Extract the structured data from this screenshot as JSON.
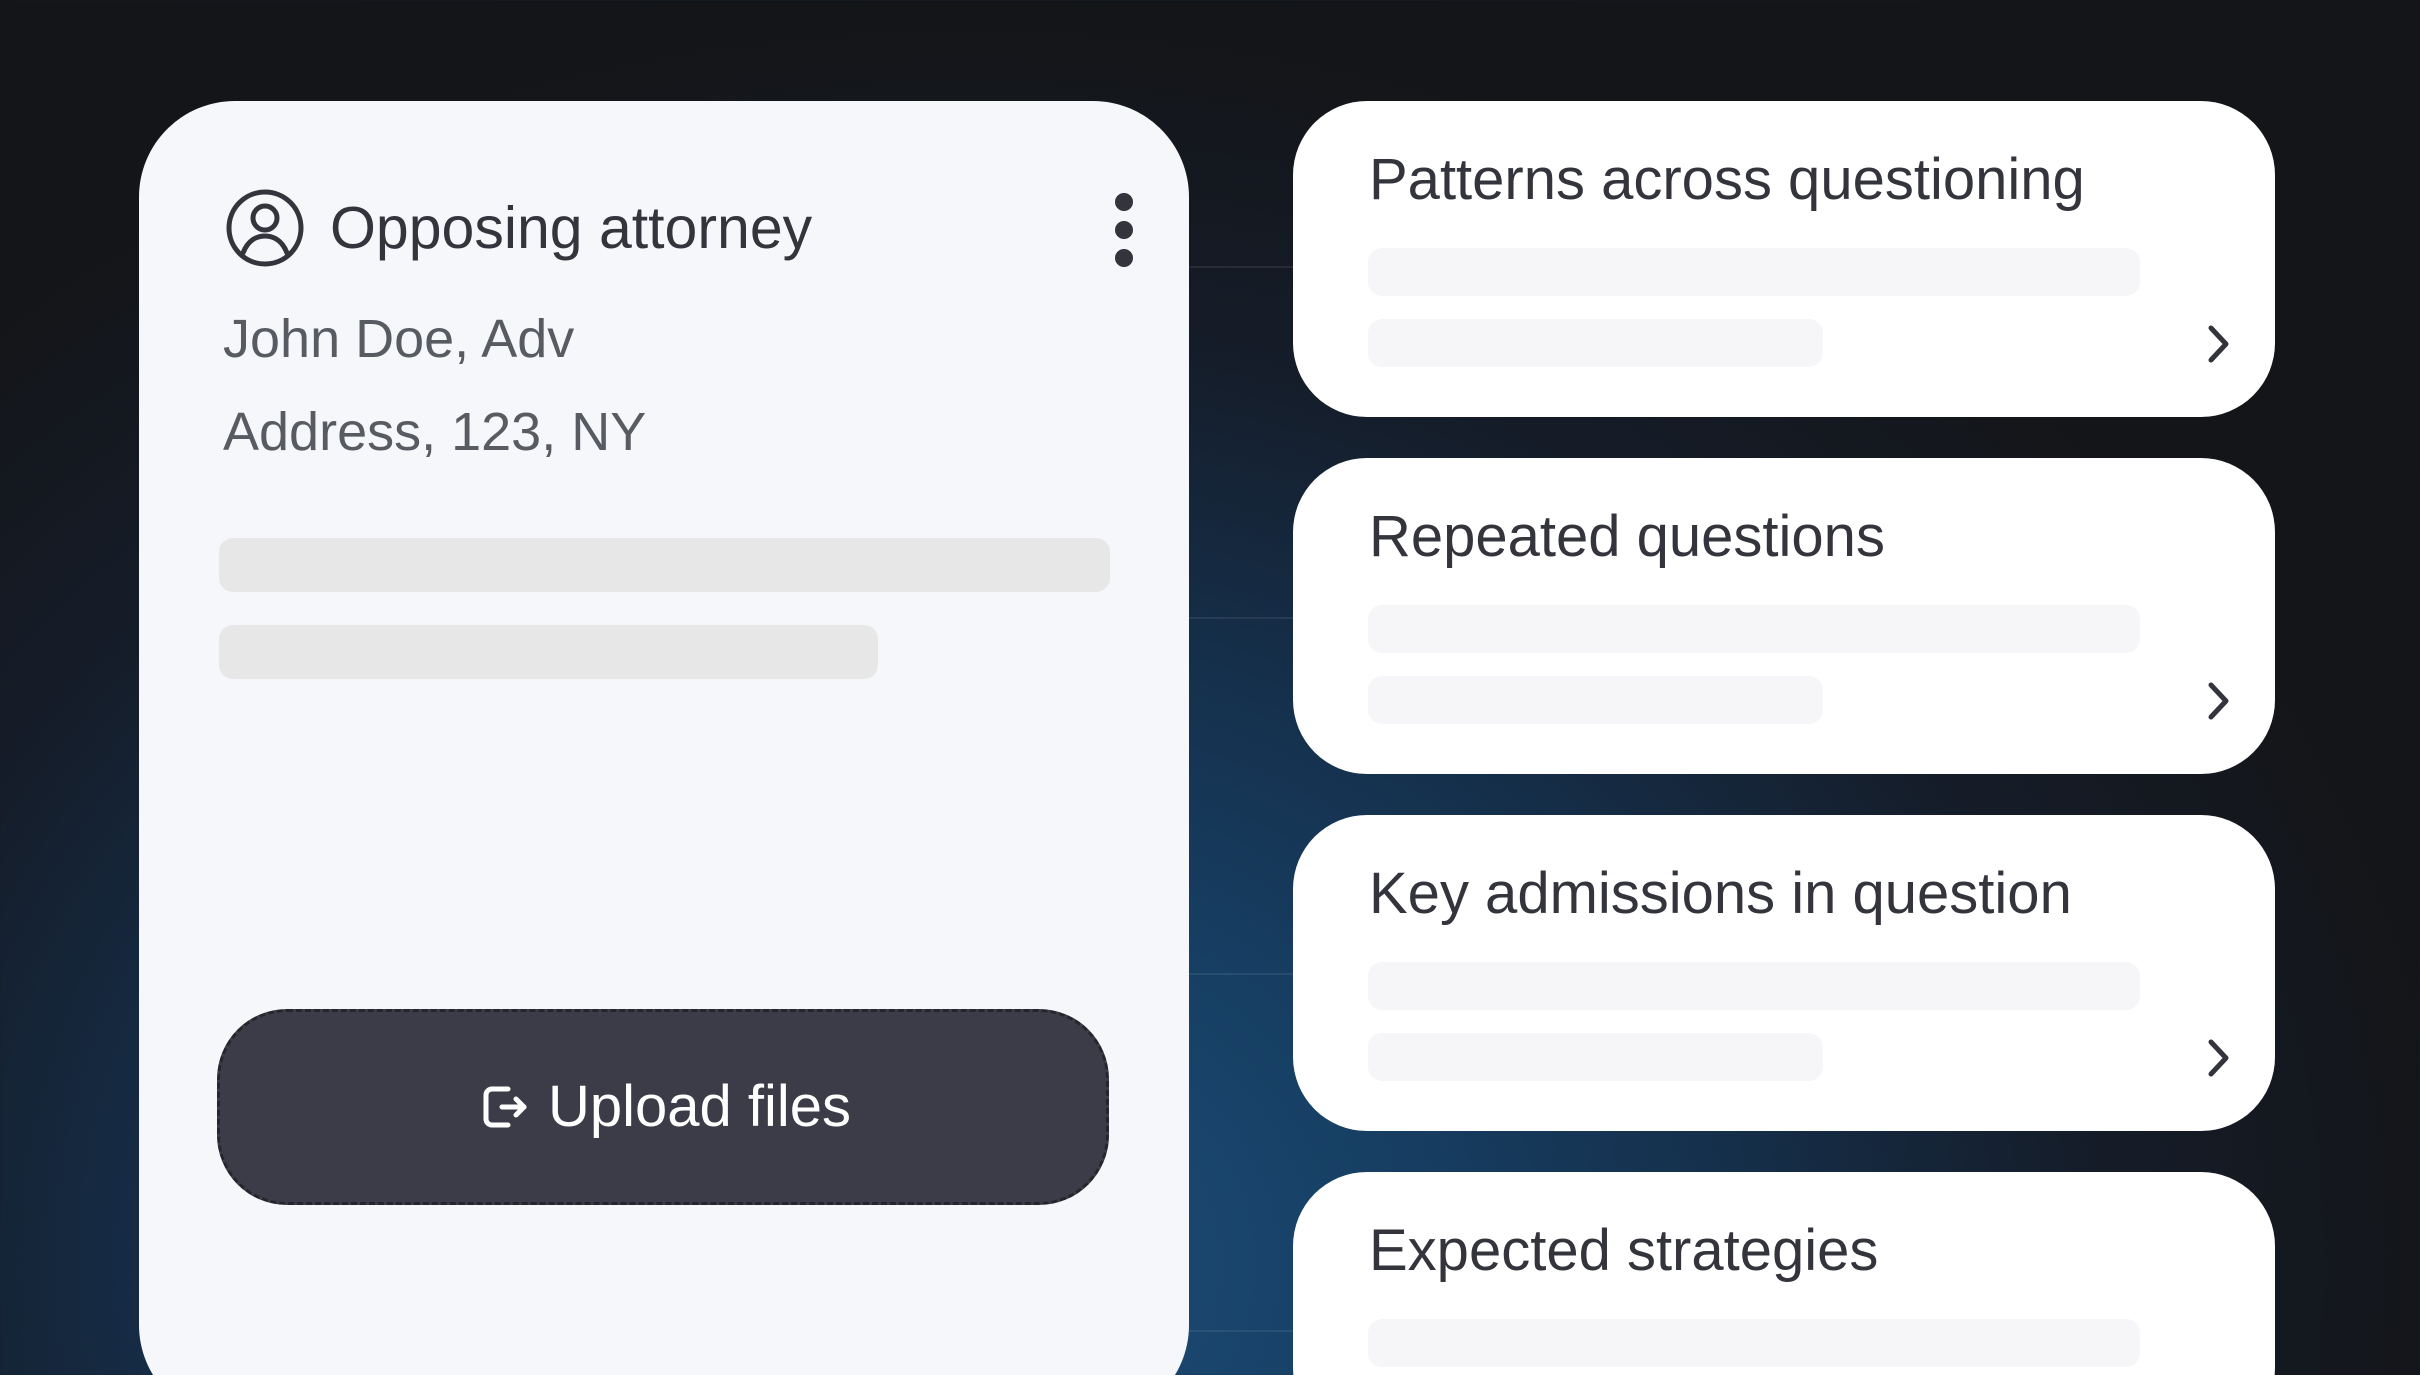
{
  "profile": {
    "title": "Opposing attorney",
    "name": "John Doe, Adv",
    "address": "Address, 123, NY",
    "icons": {
      "user": "user-circle-icon",
      "more": "more-vertical-icon",
      "upload": "upload-file-icon"
    },
    "upload_button_label": "Upload files"
  },
  "insights": [
    {
      "title": "Patterns across questioning",
      "icon": "chevron-right-icon"
    },
    {
      "title": "Repeated questions",
      "icon": "chevron-right-icon"
    },
    {
      "title": "Key admissions in question",
      "icon": "chevron-right-icon"
    },
    {
      "title": "Expected strategies"
    }
  ],
  "colors": {
    "background_dark": "#141518",
    "background_blue": "#1d4d79",
    "profile_card": "#f6f7fa",
    "insight_card": "#ffffff",
    "primary_text": "#33343c",
    "secondary_text": "#595b63",
    "placeholder": "#e7e7e8",
    "upload_button": "#3c3c48"
  }
}
